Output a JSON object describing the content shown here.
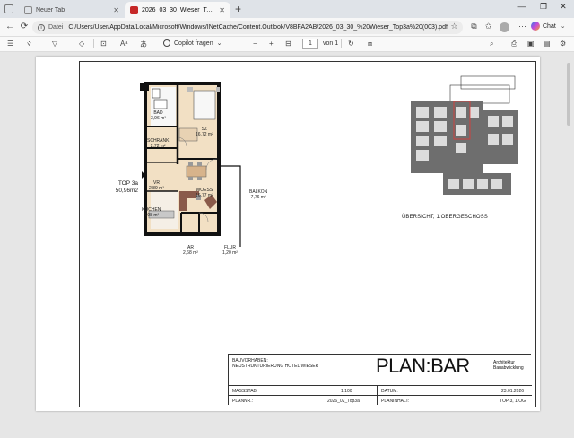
{
  "browser": {
    "tabs": [
      {
        "label": "Neuer Tab",
        "active": false
      },
      {
        "label": "2026_03_30_Wieser_Top3a (003).pdf",
        "active": true
      }
    ],
    "address": {
      "prefix": "Datei",
      "url": "C:/Users/User/AppData/Local/Microsoft/Windows/INetCache/Content.Outlook/V8BFA2AB/2026_03_30_%20Wieser_Top3a%20(003).pdf"
    },
    "chat_label": "Chat"
  },
  "pdf_toolbar": {
    "copilot_label": "Copilot fragen",
    "page_current": "1",
    "page_total": "von 1"
  },
  "plan": {
    "rooms": [
      {
        "name": "BAD",
        "area": "3,96 m²"
      },
      {
        "name": "SZ",
        "area": "16,72 m²"
      },
      {
        "name": "SCHRANK",
        "area": "2,72 m²"
      },
      {
        "name": "VR",
        "area": "2,89 m²"
      },
      {
        "name": "WOESS",
        "area": "16,77 m²"
      },
      {
        "name": "KOCHEN",
        "area": "4,08 m²"
      },
      {
        "name": "BALKON",
        "area": "7,76 m²"
      },
      {
        "name": "AR",
        "area": "2,68 m²"
      },
      {
        "name": "FLUR",
        "area": "1,20 m²"
      }
    ],
    "unit_name": "TOP 3a",
    "unit_area": "50,96m2"
  },
  "overview_caption": "ÜBERSICHT, 1.OBERGESCHOSS",
  "title_block": {
    "client_label": "BAUVORHABEN:",
    "client_value": "NEUSTRUKTURIERUNG HOTEL WIESER",
    "logo": "PLAN:BAR",
    "logo_sub_1": "Architektur",
    "logo_sub_2": "Bauabwicklung",
    "scale_label": "MASSSTAB:",
    "scale_value": "1:100",
    "date_label": "DATUM:",
    "date_value": "23.01.2026",
    "plan_no_label": "PLANNR.:",
    "plan_no_value": "2026_02_Top3a",
    "content_label": "PLANINHALT:",
    "content_value": "TOP 3, 1.OG"
  }
}
